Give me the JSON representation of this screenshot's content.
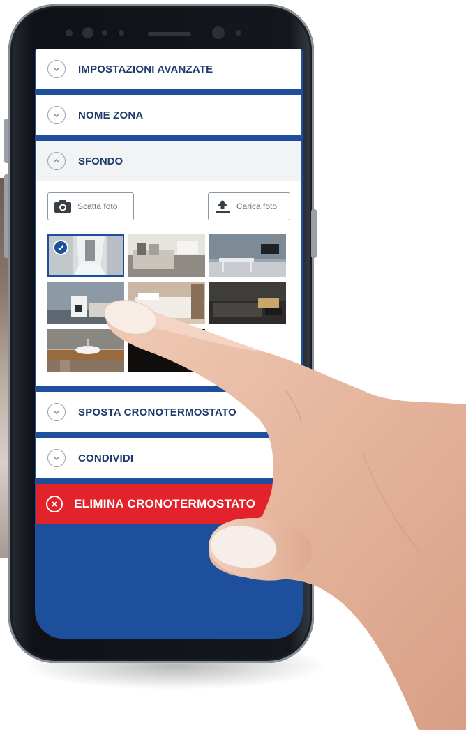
{
  "menu": {
    "advanced_settings": "IMPOSTAZIONI AVANZATE",
    "zone_name": "NOME ZONA",
    "background": "SFONDO",
    "move_thermostat": "SPOSTA CRONOTERMOSTATO",
    "share": "CONDIVIDI",
    "delete_thermostat": "ELIMINA CRONOTERMOSTATO"
  },
  "background_section": {
    "take_photo_label": "Scatta foto",
    "upload_photo_label": "Carica foto",
    "thumbnails": [
      {
        "name": "hallway",
        "selected": true
      },
      {
        "name": "living-room",
        "selected": false
      },
      {
        "name": "dining-room",
        "selected": false
      },
      {
        "name": "bedroom-thermostat",
        "selected": false
      },
      {
        "name": "bedroom",
        "selected": false
      },
      {
        "name": "dark-living-room",
        "selected": false
      },
      {
        "name": "bathroom",
        "selected": false
      },
      {
        "name": "dark-room",
        "selected": false
      }
    ]
  },
  "colors": {
    "screen_blue": "#1d4f9c",
    "label_navy": "#1f3b6e",
    "delete_red": "#e2232b"
  }
}
